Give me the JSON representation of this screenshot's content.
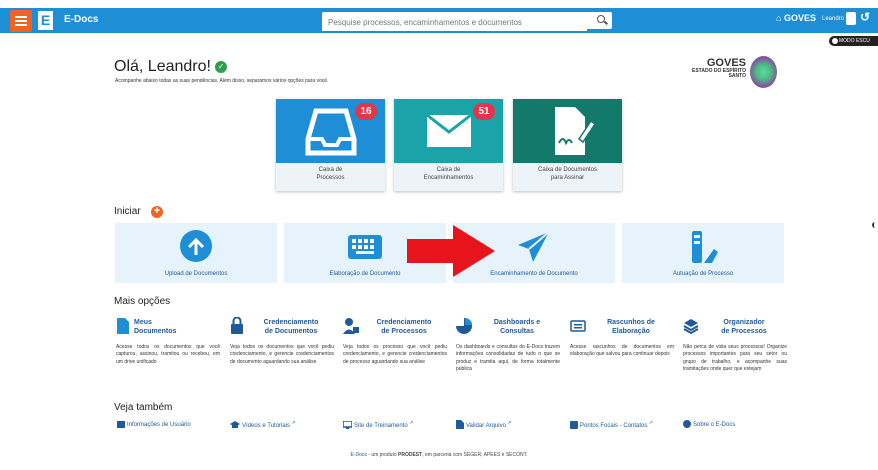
{
  "header": {
    "brand": "E-Docs",
    "search_placeholder": "Pesquise processos, encaminhamentos e documentos",
    "org": "GOVES",
    "user": "Leandro"
  },
  "dark_mode": "MODO ESCU",
  "greeting": {
    "title": "Olá, Leandro!",
    "subtitle": "Acompanhe abaixo todas as suas pendências. Além disso, separamos vários opções para você."
  },
  "org_logo": {
    "name": "GOVES",
    "line1": "ESTADO DO ESPÍRITO",
    "line2": "SANTO"
  },
  "cards": [
    {
      "l1": "Caixa de",
      "l2": "Processos",
      "badge": "16",
      "color": "#1e8fd6"
    },
    {
      "l1": "Caixa de",
      "l2": "Encaminhamentos",
      "badge": "51",
      "color": "#1aa3a8"
    },
    {
      "l1": "Caixa de Documentos",
      "l2": "para Assinar",
      "badge": "",
      "color": "#137a6b"
    }
  ],
  "iniciar": {
    "title": "Iniciar",
    "items": [
      "Upload de Documentos",
      "Elaboração de Documento",
      "Encaminhamento de Documento",
      "Autuação de Processo"
    ]
  },
  "mais": {
    "title": "Mais opções",
    "items": [
      {
        "l1": "Meus",
        "l2": "Documentos",
        "desc": "Acesse todos os documentos que você capturou, assinou, tramitou ou recebeu, em um drive unificado"
      },
      {
        "l1": "Credenciamento",
        "l2": "de Documentos",
        "desc": "Veja todos os documentos que você pediu credenciamento, e gerencie credenciamentos de documento aguardando sua análise"
      },
      {
        "l1": "Credenciamento",
        "l2": "de Processos",
        "desc": "Veja todos os processo que você pediu credenciamento, e gerencie credenciamentos de processo aguardando sua análise"
      },
      {
        "l1": "Dashboards e",
        "l2": "Consultas",
        "desc": "Os dashboards e consultas do E-Docs trazem informações consolidadas de tudo o que se produz e tramita aqui, de forma totalmente pública"
      },
      {
        "l1": "Rascunhos de",
        "l2": "Elaboração",
        "desc": "Acesse rascunhos de documentos em elaboração que salvou para continuar depois"
      },
      {
        "l1": "Organizador",
        "l2": "de Processos",
        "desc": "Não perca de vista seus processos! Organize processos importantes para seu setor ou grupo de trabalho, e acompanhe suas tramitações onde quer que estejam"
      }
    ]
  },
  "veja": {
    "title": "Veja também",
    "links": [
      "Informações de Usuário",
      "Vídeos e Tutoriais",
      "Site de Treinamento",
      "Validar Arquivo",
      "Pontos Focais - Contatos",
      "Sobre o E-Docs"
    ]
  },
  "footer": {
    "brand": "E-Docs",
    "mid": " - um produto ",
    "prodest": "PRODEST",
    "rest": ", em parceria com SEGER, APEES e SECONT."
  }
}
